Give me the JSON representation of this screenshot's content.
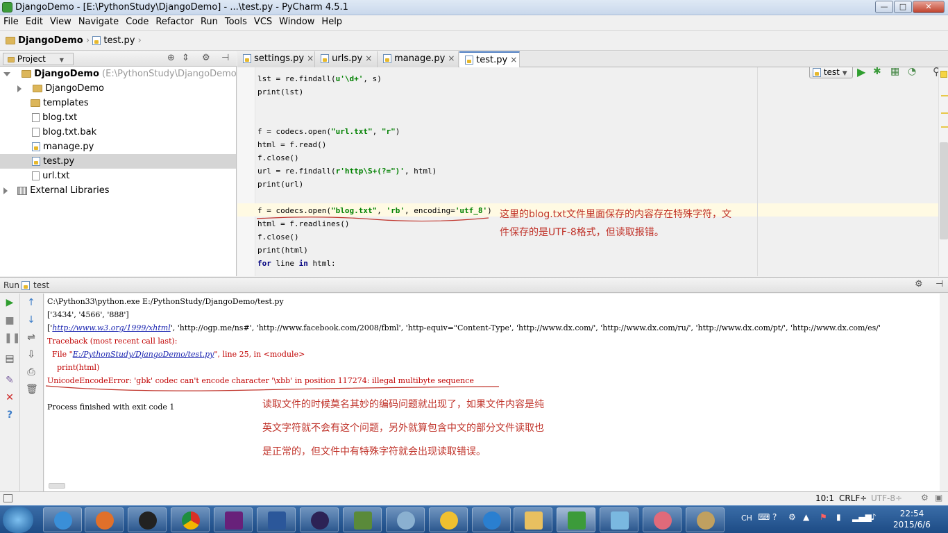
{
  "window": {
    "title": "DjangoDemo - [E:\\PythonStudy\\DjangoDemo] - ...\\test.py - PyCharm 4.5.1",
    "min_label": "—",
    "max_label": "□",
    "close_label": "✕"
  },
  "menu": [
    "File",
    "Edit",
    "View",
    "Navigate",
    "Code",
    "Refactor",
    "Run",
    "Tools",
    "VCS",
    "Window",
    "Help"
  ],
  "breadcrumb": {
    "project": "DjangoDemo",
    "file": "test.py"
  },
  "run_config": {
    "label": "test"
  },
  "project_panel": {
    "title": "Project",
    "root": {
      "name": "DjangoDemo",
      "path": "(E:\\PythonStudy\\DjangoDemo)"
    },
    "items": [
      {
        "name": "DjangoDemo",
        "kind": "folder"
      },
      {
        "name": "templates",
        "kind": "folder"
      },
      {
        "name": "blog.txt",
        "kind": "file"
      },
      {
        "name": "blog.txt.bak",
        "kind": "file"
      },
      {
        "name": "manage.py",
        "kind": "py"
      },
      {
        "name": "test.py",
        "kind": "py",
        "selected": true
      },
      {
        "name": "url.txt",
        "kind": "file"
      }
    ],
    "external": "External Libraries"
  },
  "tabs": [
    {
      "label": "settings.py",
      "close": "×"
    },
    {
      "label": "urls.py",
      "close": "×"
    },
    {
      "label": "manage.py",
      "close": "×"
    },
    {
      "label": "test.py",
      "close": "×",
      "active": true
    }
  ],
  "code": {
    "l1_a": "lst = re.findall(",
    "l1_str": "u'\\d+'",
    "l1_b": ", s)",
    "l2": "print(lst)",
    "l3_a": "f = codecs.open(",
    "l3_s1": "\"url.txt\"",
    "l3_c": ", ",
    "l3_s2": "\"r\"",
    "l3_e": ")",
    "l4": "html = f.read()",
    "l5": "f.close()",
    "l6_a": "url = re.findall(",
    "l6_str": "r'http\\S+(?=\")'",
    "l6_b": ", html)",
    "l7": "print(url)",
    "l8_a": "f = codecs.open(",
    "l8_s1": "\"blog.txt\"",
    "l8_c": ", ",
    "l8_s2": "'rb'",
    "l8_d": ", encoding=",
    "l8_s3": "'utf_8'",
    "l8_e": ")",
    "l9": "html = f.readlines()",
    "l10": "f.close()",
    "l11": "print(html)",
    "l12_kw1": "for",
    "l12_mid": " line ",
    "l12_kw2": "in",
    "l12_end": " html:"
  },
  "annotation_editor": {
    "line1": "这里的blog.txt文件里面保存的内容存在特殊字符，文",
    "line2": "件保存的是UTF-8格式，但读取报错。"
  },
  "run_panel": {
    "label": "Run",
    "config": "test"
  },
  "console": {
    "cmd": "C:\\Python33\\python.exe E:/PythonStudy/DjangoDemo/test.py",
    "out1": "['3434', '4566', '888']",
    "out2_open": "['",
    "out2_link": "http://www.w3.org/1999/xhtml",
    "out2_rest": "', 'http://ogp.me/ns#', 'http://www.facebook.com/2008/fbml', 'http-equiv=\"Content-Type', 'http://www.dx.com/', 'http://www.dx.com/ru/', 'http://www.dx.com/pt/', 'http://www.dx.com/es/'",
    "tb": "Traceback (most recent call last):",
    "file_a": "  File \"",
    "file_link": "E:/PythonStudy/DjangoDemo/test.py",
    "file_b": "\", line 25, in <module>",
    "print_line": "    print(html)",
    "error": "UnicodeEncodeError: 'gbk' codec can't encode character '\\xbb' in position 117274: illegal multibyte sequence",
    "exit": "Process finished with exit code 1"
  },
  "annotation_console": {
    "line1": "读取文件的时候莫名其妙的编码问题就出现了，如果文件内容是纯",
    "line2": "英文字符就不会有这个问题，另外就算包含中文的部分文件读取也",
    "line3": "是正常的，但文件中有特殊字符就会出现读取错误。"
  },
  "status": {
    "position": "10:1",
    "line_sep": "CRLF÷",
    "encoding": "UTF-8÷"
  },
  "taskbar": {
    "apps": [
      "ie",
      "firefox",
      "qq",
      "chrome",
      "visual-studio",
      "visio",
      "eclipse",
      "network",
      "remote",
      "qq2",
      "feather",
      "explorer",
      "pycharm",
      "notepad",
      "paint",
      "paint2"
    ],
    "lang": "CH",
    "time": "22:54",
    "date": "2015/6/6"
  },
  "colors": {
    "annotation": "#c0332a",
    "error": "#c00000",
    "link": "#1a24b0",
    "run_green": "#2f9e2f"
  }
}
